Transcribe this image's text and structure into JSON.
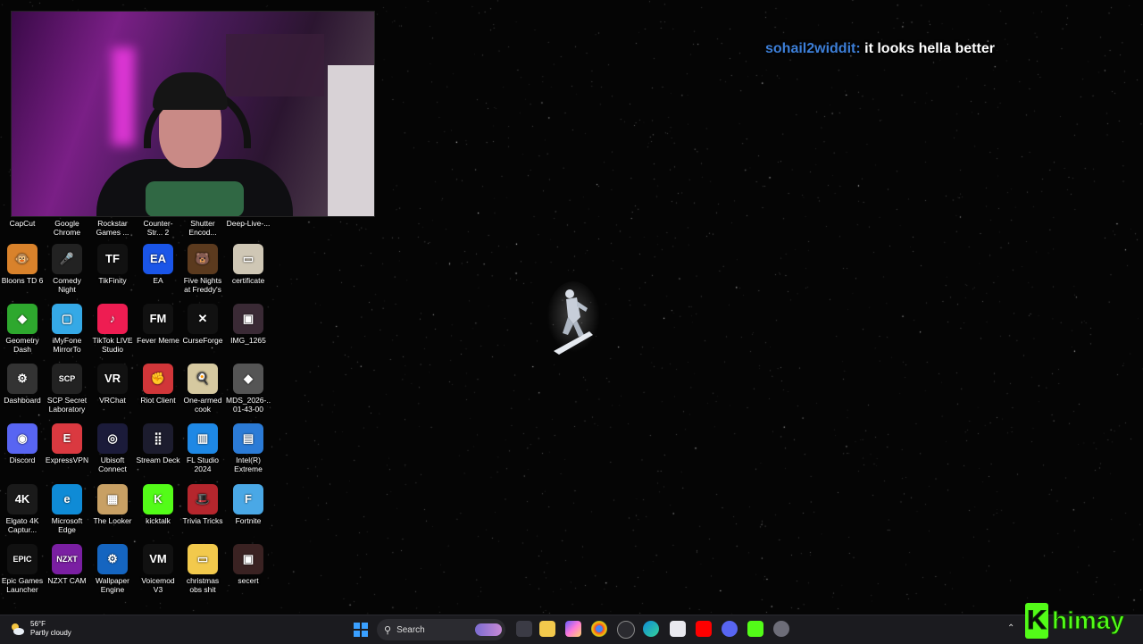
{
  "chat": {
    "username": "sohail2widdit:",
    "message": "it looks hella better",
    "username_color": "#3d7fd8"
  },
  "desktop_icons": [
    {
      "label": "CapCut",
      "color": "#000000",
      "glyph": "",
      "name": "capcut-icon"
    },
    {
      "label": "Google Chrome",
      "color": "#000000",
      "glyph": "",
      "name": "chrome-icon"
    },
    {
      "label": "Rockstar Games ...",
      "color": "#000000",
      "glyph": "",
      "name": "rockstar-icon"
    },
    {
      "label": "Counter-Str... 2",
      "color": "#000000",
      "glyph": "",
      "name": "counter-strike-icon"
    },
    {
      "label": "Shutter Encod...",
      "color": "#000000",
      "glyph": "",
      "name": "shutter-encoder-icon"
    },
    {
      "label": "Deep-Live-...",
      "color": "#000000",
      "glyph": "",
      "name": "deep-live-icon"
    },
    {
      "label": "Bloons TD 6",
      "color": "#d9822b",
      "glyph": "🐵",
      "name": "bloons-icon"
    },
    {
      "label": "Comedy Night",
      "color": "#222222",
      "glyph": "🎤",
      "name": "microphone-icon"
    },
    {
      "label": "TikFinity",
      "color": "#111111",
      "glyph": "TF",
      "name": "tikfinity-icon"
    },
    {
      "label": "EA",
      "color": "#1a55e8",
      "glyph": "EA",
      "name": "ea-icon"
    },
    {
      "label": "Five Nights at Freddy's",
      "color": "#5b3a1e",
      "glyph": "🐻",
      "name": "fnaf-icon"
    },
    {
      "label": "certificate",
      "color": "#cfc7b5",
      "glyph": "▭",
      "name": "certificate-icon"
    },
    {
      "label": "Geometry Dash",
      "color": "#2ea82e",
      "glyph": "◆",
      "name": "geometry-dash-icon"
    },
    {
      "label": "iMyFone MirrorTo",
      "color": "#35a9e6",
      "glyph": "▢",
      "name": "mirrorto-icon"
    },
    {
      "label": "TikTok LIVE Studio",
      "color": "#ee1d52",
      "glyph": "♪",
      "name": "tiktok-icon"
    },
    {
      "label": "Fever Meme",
      "color": "#111111",
      "glyph": "FM",
      "name": "fever-meme-icon"
    },
    {
      "label": "CurseForge",
      "color": "#111111",
      "glyph": "✕",
      "name": "curseforge-icon"
    },
    {
      "label": "IMG_1265",
      "color": "#3a2a35",
      "glyph": "▣",
      "name": "image-file-icon"
    },
    {
      "label": "Dashboard",
      "color": "#333333",
      "glyph": "⚙",
      "name": "dashboard-icon"
    },
    {
      "label": "SCP Secret Laboratory",
      "color": "#222222",
      "glyph": "SCP",
      "name": "scp-icon"
    },
    {
      "label": "VRChat",
      "color": "#111111",
      "glyph": "VR",
      "name": "vrchat-icon"
    },
    {
      "label": "Riot Client",
      "color": "#d13639",
      "glyph": "✊",
      "name": "riot-icon"
    },
    {
      "label": "One-armed cook",
      "color": "#d6c9a0",
      "glyph": "🍳",
      "name": "one-armed-cook-icon"
    },
    {
      "label": "MDS_2026-... 01-43-00",
      "color": "#555555",
      "glyph": "◆",
      "name": "mds-file-icon"
    },
    {
      "label": "Discord",
      "color": "#5865f2",
      "glyph": "◉",
      "name": "discord-icon"
    },
    {
      "label": "ExpressVPN",
      "color": "#da3940",
      "glyph": "E",
      "name": "expressvpn-icon"
    },
    {
      "label": "Ubisoft Connect",
      "color": "#1b1b3a",
      "glyph": "◎",
      "name": "ubisoft-icon"
    },
    {
      "label": "Stream Deck",
      "color": "#1c1c2e",
      "glyph": "⣿",
      "name": "stream-deck-icon"
    },
    {
      "label": "FL Studio 2024",
      "color": "#1e88e5",
      "glyph": "▥",
      "name": "fl-studio-icon"
    },
    {
      "label": "Intel(R) Extreme Tu...",
      "color": "#2b7bd6",
      "glyph": "▤",
      "name": "intel-xtu-icon"
    },
    {
      "label": "Elgato 4K Captur...",
      "color": "#1a1a1a",
      "glyph": "4K",
      "name": "elgato-icon"
    },
    {
      "label": "Microsoft Edge",
      "color": "#0f8bd6",
      "glyph": "e",
      "name": "edge-icon"
    },
    {
      "label": "The Looker",
      "color": "#c8a064",
      "glyph": "▦",
      "name": "the-looker-icon"
    },
    {
      "label": "kicktalk",
      "color": "#53fc18",
      "glyph": "K",
      "name": "kicktalk-icon"
    },
    {
      "label": "Trivia Tricks",
      "color": "#b5262d",
      "glyph": "🎩",
      "name": "trivia-tricks-icon"
    },
    {
      "label": "Fortnite",
      "color": "#4aa8e6",
      "glyph": "F",
      "name": "fortnite-icon"
    },
    {
      "label": "Epic Games Launcher",
      "color": "#111111",
      "glyph": "EPIC",
      "name": "epic-games-icon"
    },
    {
      "label": "NZXT CAM",
      "color": "#7a1fa2",
      "glyph": "NZXT",
      "name": "nzxt-icon"
    },
    {
      "label": "Wallpaper Engine",
      "color": "#1565c0",
      "glyph": "⚙",
      "name": "wallpaper-engine-icon"
    },
    {
      "label": "Voicemod V3",
      "color": "#111111",
      "glyph": "VM",
      "name": "voicemod-icon"
    },
    {
      "label": "christmas obs shit",
      "color": "#f2c94c",
      "glyph": "▭",
      "name": "folder-icon"
    },
    {
      "label": "secert",
      "color": "#3a2222",
      "glyph": "▣",
      "name": "image-file-icon-2"
    }
  ],
  "taskbar": {
    "weather_temp": "56°F",
    "weather_desc": "Partly cloudy",
    "search_label": "Search",
    "logo_text": "himay"
  }
}
